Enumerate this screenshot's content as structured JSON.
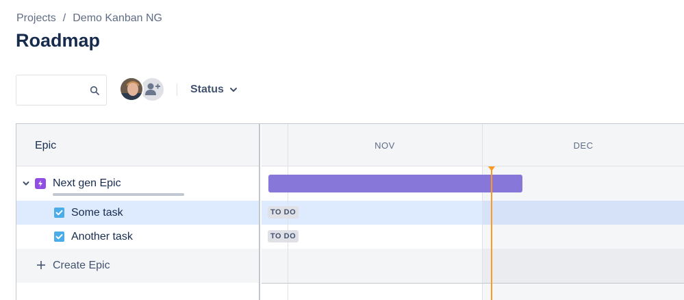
{
  "breadcrumb": {
    "project": "Projects",
    "separator": "/",
    "board": "Demo Kanban NG"
  },
  "page": {
    "title": "Roadmap"
  },
  "search": {
    "value": "",
    "placeholder": "",
    "icon": "search-icon"
  },
  "filters": {
    "status_label": "Status",
    "avatar_icon": "user-avatar",
    "add_user_icon": "add-user-icon"
  },
  "grid": {
    "left_header": "Epic",
    "months": [
      "NOV",
      "DEC"
    ],
    "epic": {
      "label": "Next gen Epic",
      "color": "#904ee2",
      "bar_color": "#8777d9"
    },
    "tasks": [
      {
        "label": "Some task",
        "status": "TO DO",
        "selected": true
      },
      {
        "label": "Another task",
        "status": "TO DO",
        "selected": false
      }
    ],
    "create_label": "Create Epic",
    "today_color": "#ff991f"
  }
}
